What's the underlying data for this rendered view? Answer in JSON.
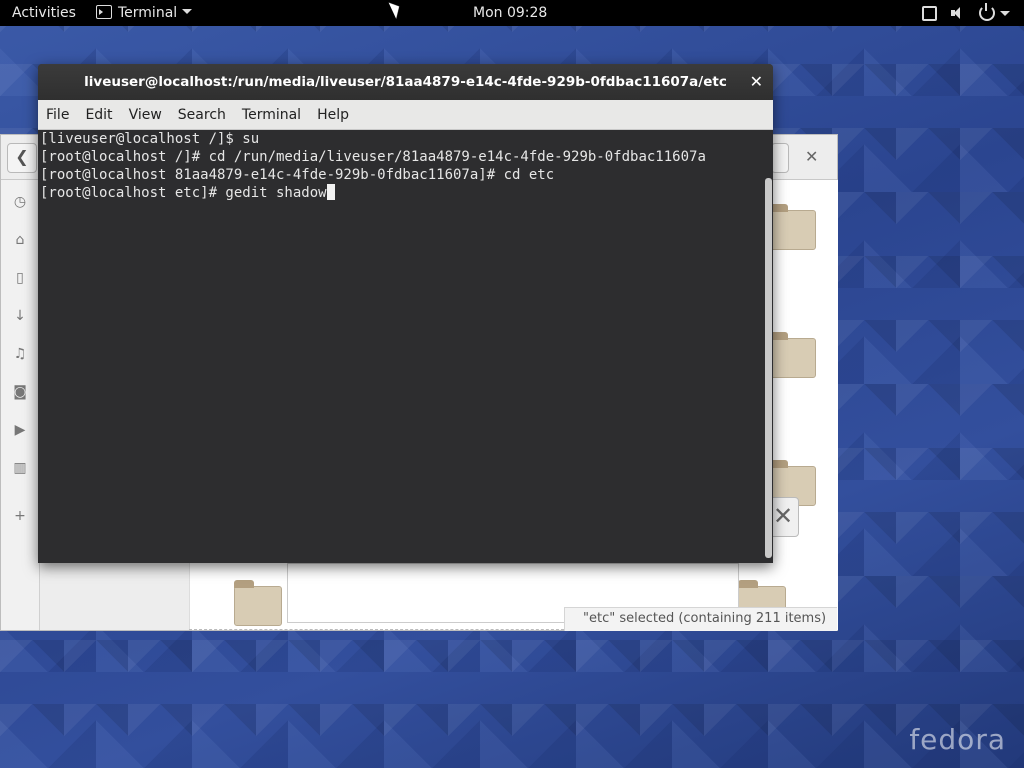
{
  "topbar": {
    "activities": "Activities",
    "app_menu": "Terminal",
    "clock": "Mon 09:28"
  },
  "terminal": {
    "title": "liveuser@localhost:/run/media/liveuser/81aa4879-e14c-4fde-929b-0fdbac11607a/etc",
    "close_symbol": "✕",
    "menu": [
      "File",
      "Edit",
      "View",
      "Search",
      "Terminal",
      "Help"
    ],
    "lines": [
      "[liveuser@localhost /]$ su",
      "[root@localhost /]# cd /run/media/liveuser/81aa4879-e14c-4fde-929b-0fdbac11607a",
      "[root@localhost 81aa4879-e14c-4fde-929b-0fdbac11607a]# cd etc",
      "[root@localhost etc]# gedit shadow"
    ]
  },
  "files": {
    "status": "\"etc\" selected (containing 211 items)",
    "back_symbol": "❮",
    "close_symbol": "✕",
    "dismiss_symbol": "✕",
    "sidebar_icons": [
      "clock-icon",
      "home-icon",
      "document-icon",
      "download-icon",
      "music-icon",
      "camera-icon",
      "video-icon",
      "trash-icon",
      "plus-icon"
    ]
  },
  "desktop": {
    "logo": "fedora"
  },
  "colors": {
    "topbar_bg": "#000000",
    "terminal_bg": "#2d2d2f",
    "desktop_blue": "#2b4590",
    "menubar_bg": "#e8e8e7"
  }
}
